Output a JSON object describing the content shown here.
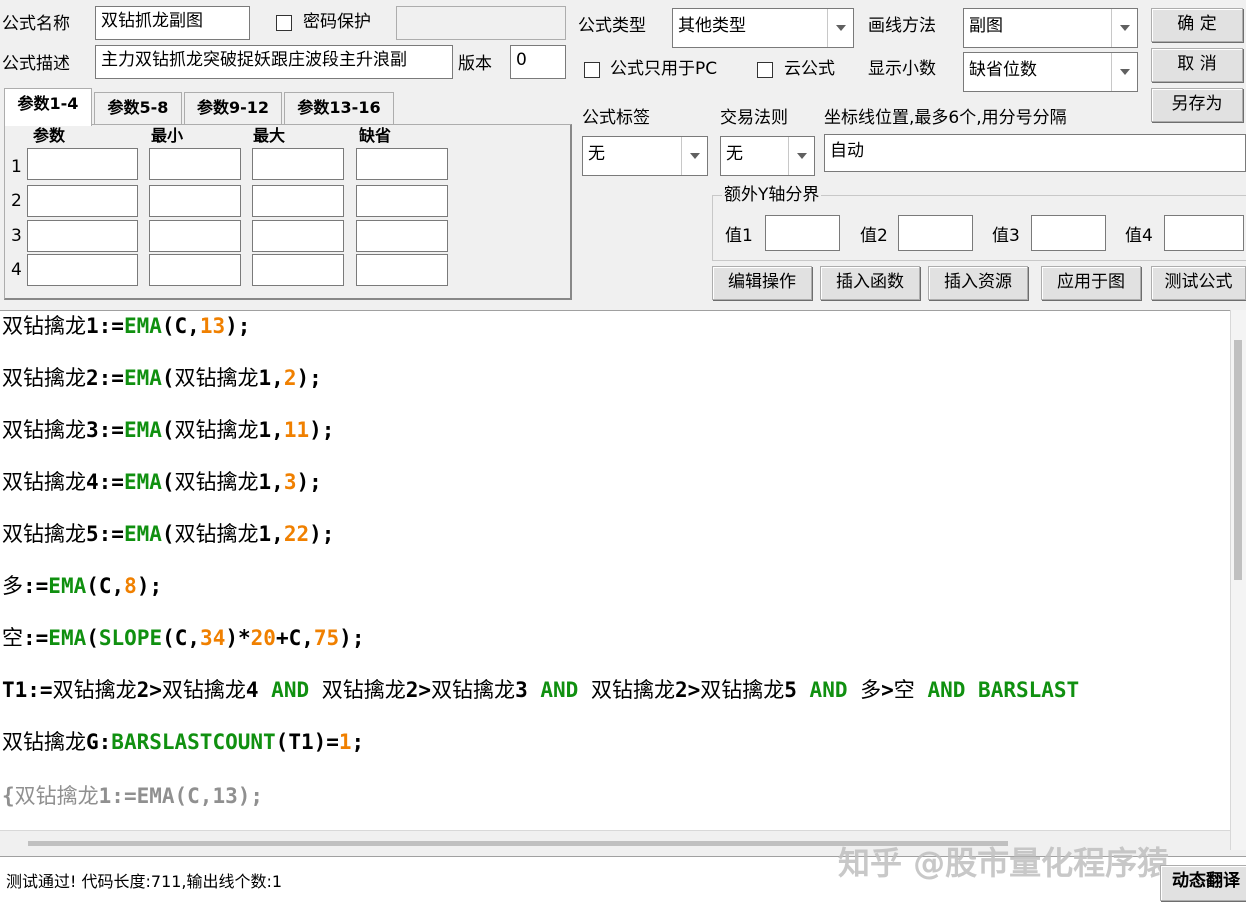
{
  "header": {
    "name_label": "公式名称",
    "name_value": "双钻抓龙副图",
    "password_label": "密码保护",
    "password_value": "",
    "desc_label": "公式描述",
    "desc_value": "主力双钻抓龙突破捉妖跟庄波段主升浪副",
    "version_label": "版本",
    "version_value": "0",
    "type_label": "公式类型",
    "type_value": "其他类型",
    "draw_label": "画线方法",
    "draw_value": "副图",
    "pc_only_label": "公式只用于PC",
    "cloud_label": "云公式",
    "decimals_label": "显示小数",
    "decimals_value": "缺省位数"
  },
  "buttons": {
    "ok": "确  定",
    "cancel": "取  消",
    "save_as": "另存为",
    "edit_op": "编辑操作",
    "insert_func": "插入函数",
    "insert_res": "插入资源",
    "apply_chart": "应用于图",
    "test_formula": "测试公式",
    "dyn_translate": "动态翻译"
  },
  "params": {
    "tabs": [
      "参数1-4",
      "参数5-8",
      "参数9-12",
      "参数13-16"
    ],
    "columns": [
      "参数",
      "最小",
      "最大",
      "缺省"
    ],
    "rows": [
      "1",
      "2",
      "3",
      "4"
    ]
  },
  "options": {
    "tag_label": "公式标签",
    "tag_value": "无",
    "rule_label": "交易法则",
    "rule_value": "无",
    "axis_label": "坐标线位置,最多6个,用分号分隔",
    "axis_value": "自动",
    "yaxis_group": "额外Y轴分界",
    "value_labels": [
      "值1",
      "值2",
      "值3",
      "值4"
    ]
  },
  "code": {
    "l1": {
      "a": "双钻擒龙",
      "b": "1:=",
      "c": "EMA",
      "d": "(C,",
      "e": "13",
      "f": ");"
    },
    "l2": {
      "a": "双钻擒龙",
      "b": "2:=",
      "c": "EMA",
      "d": "(",
      "e": "双钻擒龙",
      "f": "1,",
      "g": "2",
      "h": ");"
    },
    "l3": {
      "a": "双钻擒龙",
      "b": "3:=",
      "c": "EMA",
      "d": "(",
      "e": "双钻擒龙",
      "f": "1,",
      "g": "11",
      "h": ");"
    },
    "l4": {
      "a": "双钻擒龙",
      "b": "4:=",
      "c": "EMA",
      "d": "(",
      "e": "双钻擒龙",
      "f": "1,",
      "g": "3",
      "h": ");"
    },
    "l5": {
      "a": "双钻擒龙",
      "b": "5:=",
      "c": "EMA",
      "d": "(",
      "e": "双钻擒龙",
      "f": "1,",
      "g": "22",
      "h": ");"
    },
    "l6": {
      "a": "多",
      "b": ":=",
      "c": "EMA",
      "d": "(C,",
      "e": "8",
      "f": ");"
    },
    "l7": {
      "a": "空",
      "b": ":=",
      "c": "EMA",
      "d": "(",
      "e": "SLOPE",
      "f": "(C,",
      "g": "34",
      "h": ")*",
      "i": "20",
      "j": "+C,",
      "k": "75",
      "l": ");"
    },
    "l8": {
      "a": "T1:=",
      "b": "双钻擒龙",
      "c": "2>",
      "d": "双钻擒龙",
      "e": "4 ",
      "f": "AND",
      "g": " ",
      "h": "双钻擒龙",
      "i": "2>",
      "j": "双钻擒龙",
      "k": "3 ",
      "l": "AND",
      "m": " ",
      "n": "双钻擒龙",
      "o": "2>",
      "p": "双钻擒龙",
      "q": "5 ",
      "r": "AND",
      "s": " ",
      "t": "多",
      "u": ">",
      "v": "空",
      "w": " ",
      "x": "AND",
      "y": " ",
      "z": "BARSLAST"
    },
    "l9": {
      "a": "双钻擒龙",
      "b": "G:",
      "c": "BARSLASTCOUNT",
      "d": "(T1)=",
      "e": "1",
      "f": ";"
    },
    "l10": {
      "a": "{",
      "b": "双钻擒龙",
      "c": "1:=EMA(C,13);"
    }
  },
  "status": {
    "message": "测试通过! 代码长度:711,输出线个数:1",
    "watermark": "知乎 @股市量化程序猿"
  }
}
